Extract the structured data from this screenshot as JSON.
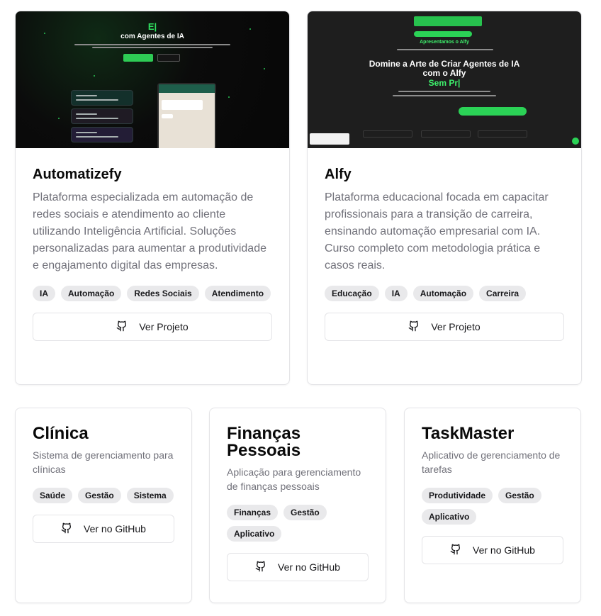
{
  "projects": [
    {
      "title": "Automatizefy",
      "description": "Plataforma especializada em automação de redes sociais e atendimento ao cliente utilizando Inteligência Artificial. Soluções personalizadas para aumentar a produtividade e engajamento digital das empresas.",
      "tags": [
        "IA",
        "Automação",
        "Redes Sociais",
        "Atendimento"
      ],
      "button_label": "Ver Projeto",
      "button_icon": "github-icon",
      "screenshot": {
        "logo": "E|",
        "headline": "com Agentes de IA"
      }
    },
    {
      "title": "Alfy",
      "description": "Plataforma educacional focada em capacitar profissionais para a transição de carreira, ensinando automação empresarial com IA. Curso completo com metodologia prática e casos reais.",
      "tags": [
        "Educação",
        "IA",
        "Automação",
        "Carreira"
      ],
      "button_label": "Ver Projeto",
      "button_icon": "github-icon",
      "screenshot": {
        "small_title": "Apresentamos o Alfy",
        "headline": "Domine a Arte de Criar Agentes de IA com o Alfy",
        "typed": "Sem Pr|"
      }
    }
  ],
  "repos": [
    {
      "title": "Clínica",
      "description": "Sistema de gerenciamento para clínicas",
      "tags": [
        "Saúde",
        "Gestão",
        "Sistema"
      ],
      "button_label": "Ver no GitHub",
      "button_icon": "github-icon"
    },
    {
      "title": "Finanças Pessoais",
      "description": "Aplicação para gerenciamento de finanças pessoais",
      "tags": [
        "Finanças",
        "Gestão",
        "Aplicativo"
      ],
      "button_label": "Ver no GitHub",
      "button_icon": "github-icon"
    },
    {
      "title": "TaskMaster",
      "description": "Aplicativo de gerenciamento de tarefas",
      "tags": [
        "Produtividade",
        "Gestão",
        "Aplicativo"
      ],
      "button_label": "Ver no GitHub",
      "button_icon": "github-icon"
    }
  ],
  "colors": {
    "accent_green": "#2bd256",
    "card_border": "#e4e4e7",
    "muted_text": "#71717a",
    "tag_bg": "#e9e9eb"
  }
}
